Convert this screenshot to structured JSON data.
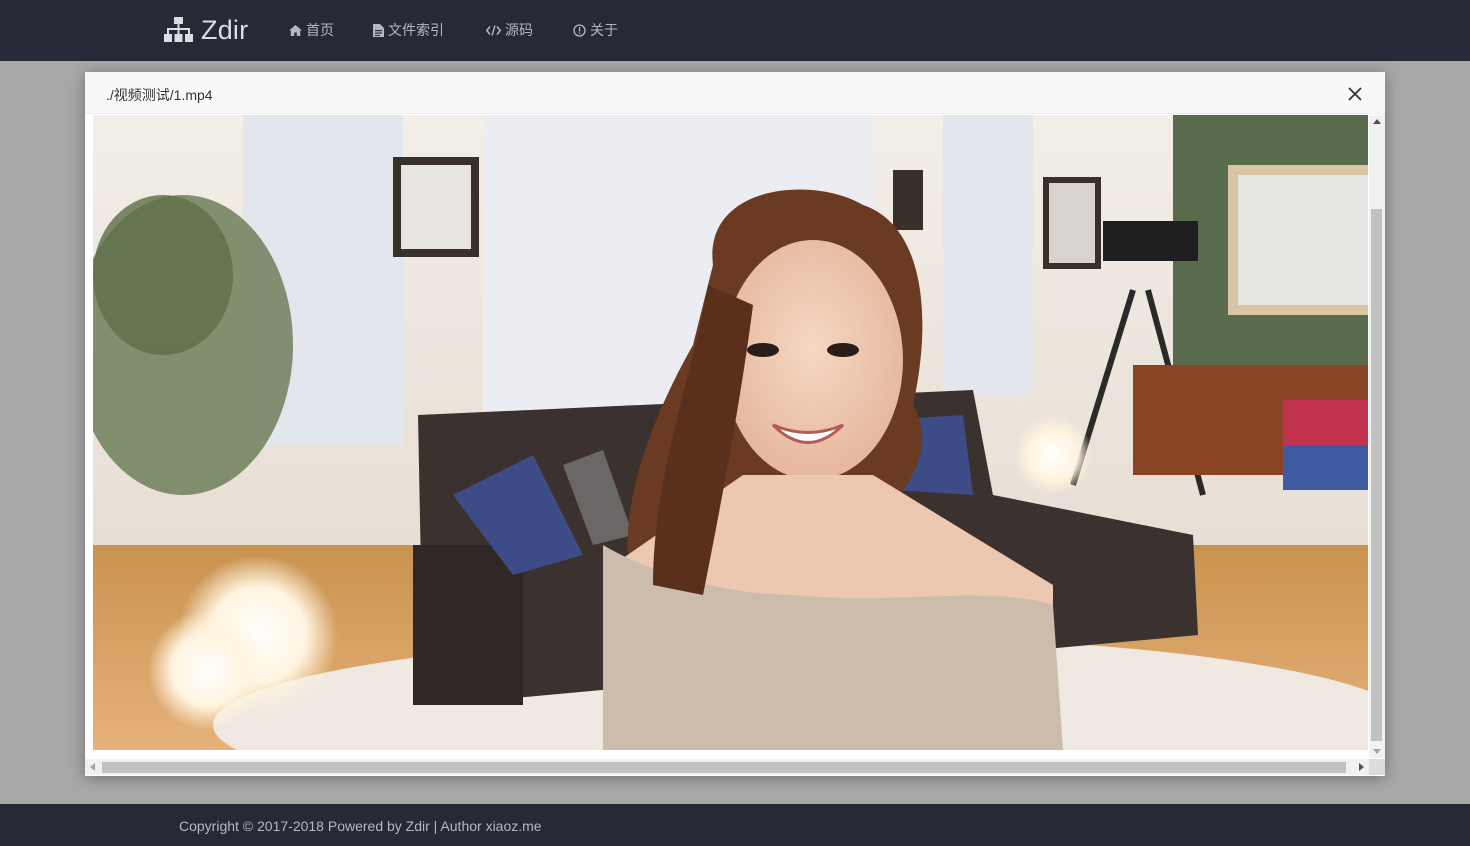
{
  "brand": {
    "name": "Zdir",
    "icon": "sitemap-icon"
  },
  "nav": [
    {
      "label": "首页",
      "icon": "home-icon"
    },
    {
      "label": "文件索引",
      "icon": "file-icon"
    },
    {
      "label": "源码",
      "icon": "code-icon"
    },
    {
      "label": "关于",
      "icon": "info-icon"
    }
  ],
  "modal": {
    "title": "./视频测试/1.mp4",
    "close_icon": "close-icon"
  },
  "footer": {
    "text": "Copyright © 2017-2018 Powered by Zdir | Author xiaoz.me"
  },
  "colors": {
    "navbar": "#262a37",
    "overlay": "#a8a8a9",
    "nav_text": "#b6b8c0"
  }
}
